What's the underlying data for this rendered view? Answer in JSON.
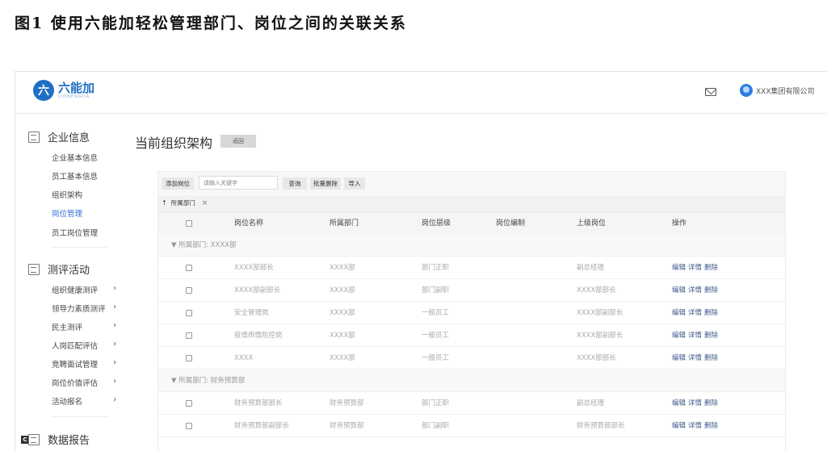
{
  "caption": "图1 使用六能加轻松管理部门、岗位之间的关联关系",
  "header": {
    "logo_mark": "六",
    "logo_text": "六能加",
    "logo_sub": "LIONENGJIA",
    "user_name": "XXX集团有限公司"
  },
  "sidebar": {
    "sections": [
      {
        "label": "企业信息",
        "icon": "building-icon"
      },
      {
        "label": "测评活动",
        "icon": "clipboard-icon"
      },
      {
        "label": "数据报告",
        "icon": "document-icon"
      }
    ],
    "enterprise_items": [
      "企业基本信息",
      "员工基本信息",
      "组织架构",
      "岗位管理",
      "员工岗位管理"
    ],
    "eval_items": [
      "组织健康测评",
      "领导力素质测评",
      "民主测评",
      "人岗匹配评估",
      "竞聘面试管理",
      "岗位价值评估",
      "活动报名"
    ],
    "chevron": "›",
    "badge": "C"
  },
  "main": {
    "title": "当前组织架构",
    "back_label": "返回"
  },
  "toolbar": {
    "add_label": "添加岗位",
    "search_placeholder": "请输入关键字",
    "query_label": "查询",
    "batch_delete_label": "批量删除",
    "import_label": "导入"
  },
  "group_chip": {
    "arrow": "↑",
    "label": "所属部门",
    "close": "×"
  },
  "table": {
    "headers": [
      "岗位名称",
      "所属部门",
      "岗位层级",
      "岗位编制",
      "上级岗位",
      "操作"
    ],
    "groups": [
      {
        "label": "▼  所属部门: XXXX部",
        "rows": [
          {
            "name": "XXXX部部长",
            "dept": "XXXX部",
            "level": "部门正职",
            "quota": "",
            "parent": "副总经理"
          },
          {
            "name": "XXXX部副部长",
            "dept": "XXXX部",
            "level": "部门副职",
            "quota": "",
            "parent": "XXXX部部长"
          },
          {
            "name": "安全管理岗",
            "dept": "XXXX部",
            "level": "一般员工",
            "quota": "",
            "parent": "XXXX部副部长"
          },
          {
            "name": "疫情舆情防控岗",
            "dept": "XXXX部",
            "level": "一般员工",
            "quota": "",
            "parent": "XXXX部副部长"
          },
          {
            "name": "XXXX",
            "dept": "XXXX部",
            "level": "一般员工",
            "quota": "",
            "parent": "XXXX部部长"
          }
        ]
      },
      {
        "label": "▼  所属部门: 财务预算部",
        "rows": [
          {
            "name": "财务预算部部长",
            "dept": "财务预算部",
            "level": "部门正职",
            "quota": "",
            "parent": "副总经理"
          },
          {
            "name": "财务预算部副部长",
            "dept": "财务预算部",
            "level": "部门副职",
            "quota": "",
            "parent": "财务预算部部长"
          }
        ]
      }
    ],
    "ops": [
      "编辑",
      "详情",
      "删除"
    ]
  }
}
